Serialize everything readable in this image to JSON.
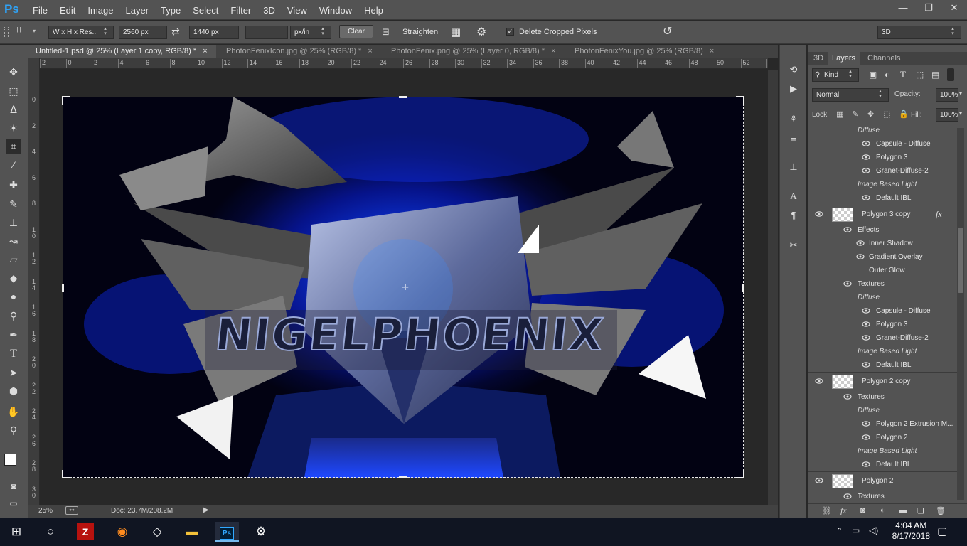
{
  "app": {
    "logo": "Ps"
  },
  "menu": [
    "File",
    "Edit",
    "Image",
    "Layer",
    "Type",
    "Select",
    "Filter",
    "3D",
    "View",
    "Window",
    "Help"
  ],
  "window_controls": {
    "minimize": "—",
    "restore": "❐",
    "close": "✕"
  },
  "options": {
    "ratio_preset": "W x H x Res...",
    "width": "2560 px",
    "height": "1440 px",
    "resolution": "",
    "unit": "px/in",
    "clear_label": "Clear",
    "straighten_label": "Straighten",
    "delete_cropped_label": "Delete Cropped Pixels",
    "delete_cropped_checked": true,
    "workspace": "3D"
  },
  "tabs": [
    {
      "label": "Untitled-1.psd @ 25% (Layer 1 copy, RGB/8) *",
      "close": "×",
      "active": true
    },
    {
      "label": "PhotonFenixIcon.jpg @ 25% (RGB/8) *",
      "close": "×",
      "active": false
    },
    {
      "label": "PhotonFenix.png @ 25% (Layer 0, RGB/8) *",
      "close": "×",
      "active": false
    },
    {
      "label": "PhotonFenixYou.jpg @ 25% (RGB/8)",
      "close": "×",
      "active": false
    }
  ],
  "ruler_h": [
    "2",
    "0",
    "2",
    "4",
    "6",
    "8",
    "10",
    "12",
    "14",
    "16",
    "18",
    "20",
    "22",
    "24",
    "26",
    "28",
    "30",
    "32",
    "34",
    "36",
    "38",
    "40",
    "42",
    "44",
    "46",
    "48",
    "50",
    "52",
    "54"
  ],
  "ruler_v": [
    "0",
    "2",
    "4",
    "6",
    "8",
    "1\n0",
    "1\n2",
    "1\n4",
    "1\n6",
    "1\n8",
    "2\n0",
    "2\n2",
    "2\n4",
    "2\n6",
    "2\n8",
    "3\n0"
  ],
  "artwork_text": "NIGELPHOENIX",
  "status": {
    "zoom": "25%",
    "doc": "Doc: 23.7M/208.2M"
  },
  "panel": {
    "tabs": [
      "3D",
      "Layers",
      "Channels"
    ],
    "filter_kind": "Kind",
    "blend_mode": "Normal",
    "opacity_label": "Opacity:",
    "opacity_value": "100%",
    "lock_label": "Lock:",
    "fill_label": "Fill:",
    "fill_value": "100%",
    "rows": [
      {
        "type": "sub",
        "text": "Diffuse",
        "italic": true
      },
      {
        "type": "tex",
        "text": "Capsule - Diffuse"
      },
      {
        "type": "tex",
        "text": "Polygon 3"
      },
      {
        "type": "tex",
        "text": "Granet-Diffuse-2"
      },
      {
        "type": "sub",
        "text": "Image Based Light",
        "italic": true
      },
      {
        "type": "tex",
        "text": "Default IBL"
      },
      {
        "type": "layer",
        "text": "Polygon 3 copy",
        "fx": "fx"
      },
      {
        "type": "eff",
        "text": "Effects"
      },
      {
        "type": "effitem",
        "text": "Inner Shadow"
      },
      {
        "type": "effitem",
        "text": "Gradient Overlay"
      },
      {
        "type": "effitem-noeye",
        "text": "Outer Glow"
      },
      {
        "type": "eff",
        "text": "Textures"
      },
      {
        "type": "sub",
        "text": "Diffuse",
        "italic": true
      },
      {
        "type": "tex",
        "text": "Capsule - Diffuse"
      },
      {
        "type": "tex",
        "text": "Polygon 3"
      },
      {
        "type": "tex",
        "text": "Granet-Diffuse-2"
      },
      {
        "type": "sub",
        "text": "Image Based Light",
        "italic": true
      },
      {
        "type": "tex",
        "text": "Default IBL"
      },
      {
        "type": "layer",
        "text": "Polygon 2 copy",
        "fx": ""
      },
      {
        "type": "eff",
        "text": "Textures"
      },
      {
        "type": "sub",
        "text": "Diffuse",
        "italic": true
      },
      {
        "type": "tex",
        "text": "Polygon 2 Extrusion M..."
      },
      {
        "type": "tex",
        "text": "Polygon 2"
      },
      {
        "type": "sub",
        "text": "Image Based Light",
        "italic": true
      },
      {
        "type": "tex",
        "text": "Default IBL"
      },
      {
        "type": "layer",
        "text": "Polygon 2",
        "fx": ""
      },
      {
        "type": "eff",
        "text": "Textures"
      }
    ],
    "footer_fx": "fx"
  },
  "taskbar": {
    "time": "4:04 AM",
    "date": "8/17/2018",
    "apps": [
      "start",
      "cortana",
      "filezilla",
      "firefox",
      "unity",
      "file-explorer",
      "photoshop",
      "settings"
    ]
  },
  "colors": {
    "accent": "#2fa3f7",
    "bg": "#535353",
    "canvas_bg": "#282828"
  }
}
